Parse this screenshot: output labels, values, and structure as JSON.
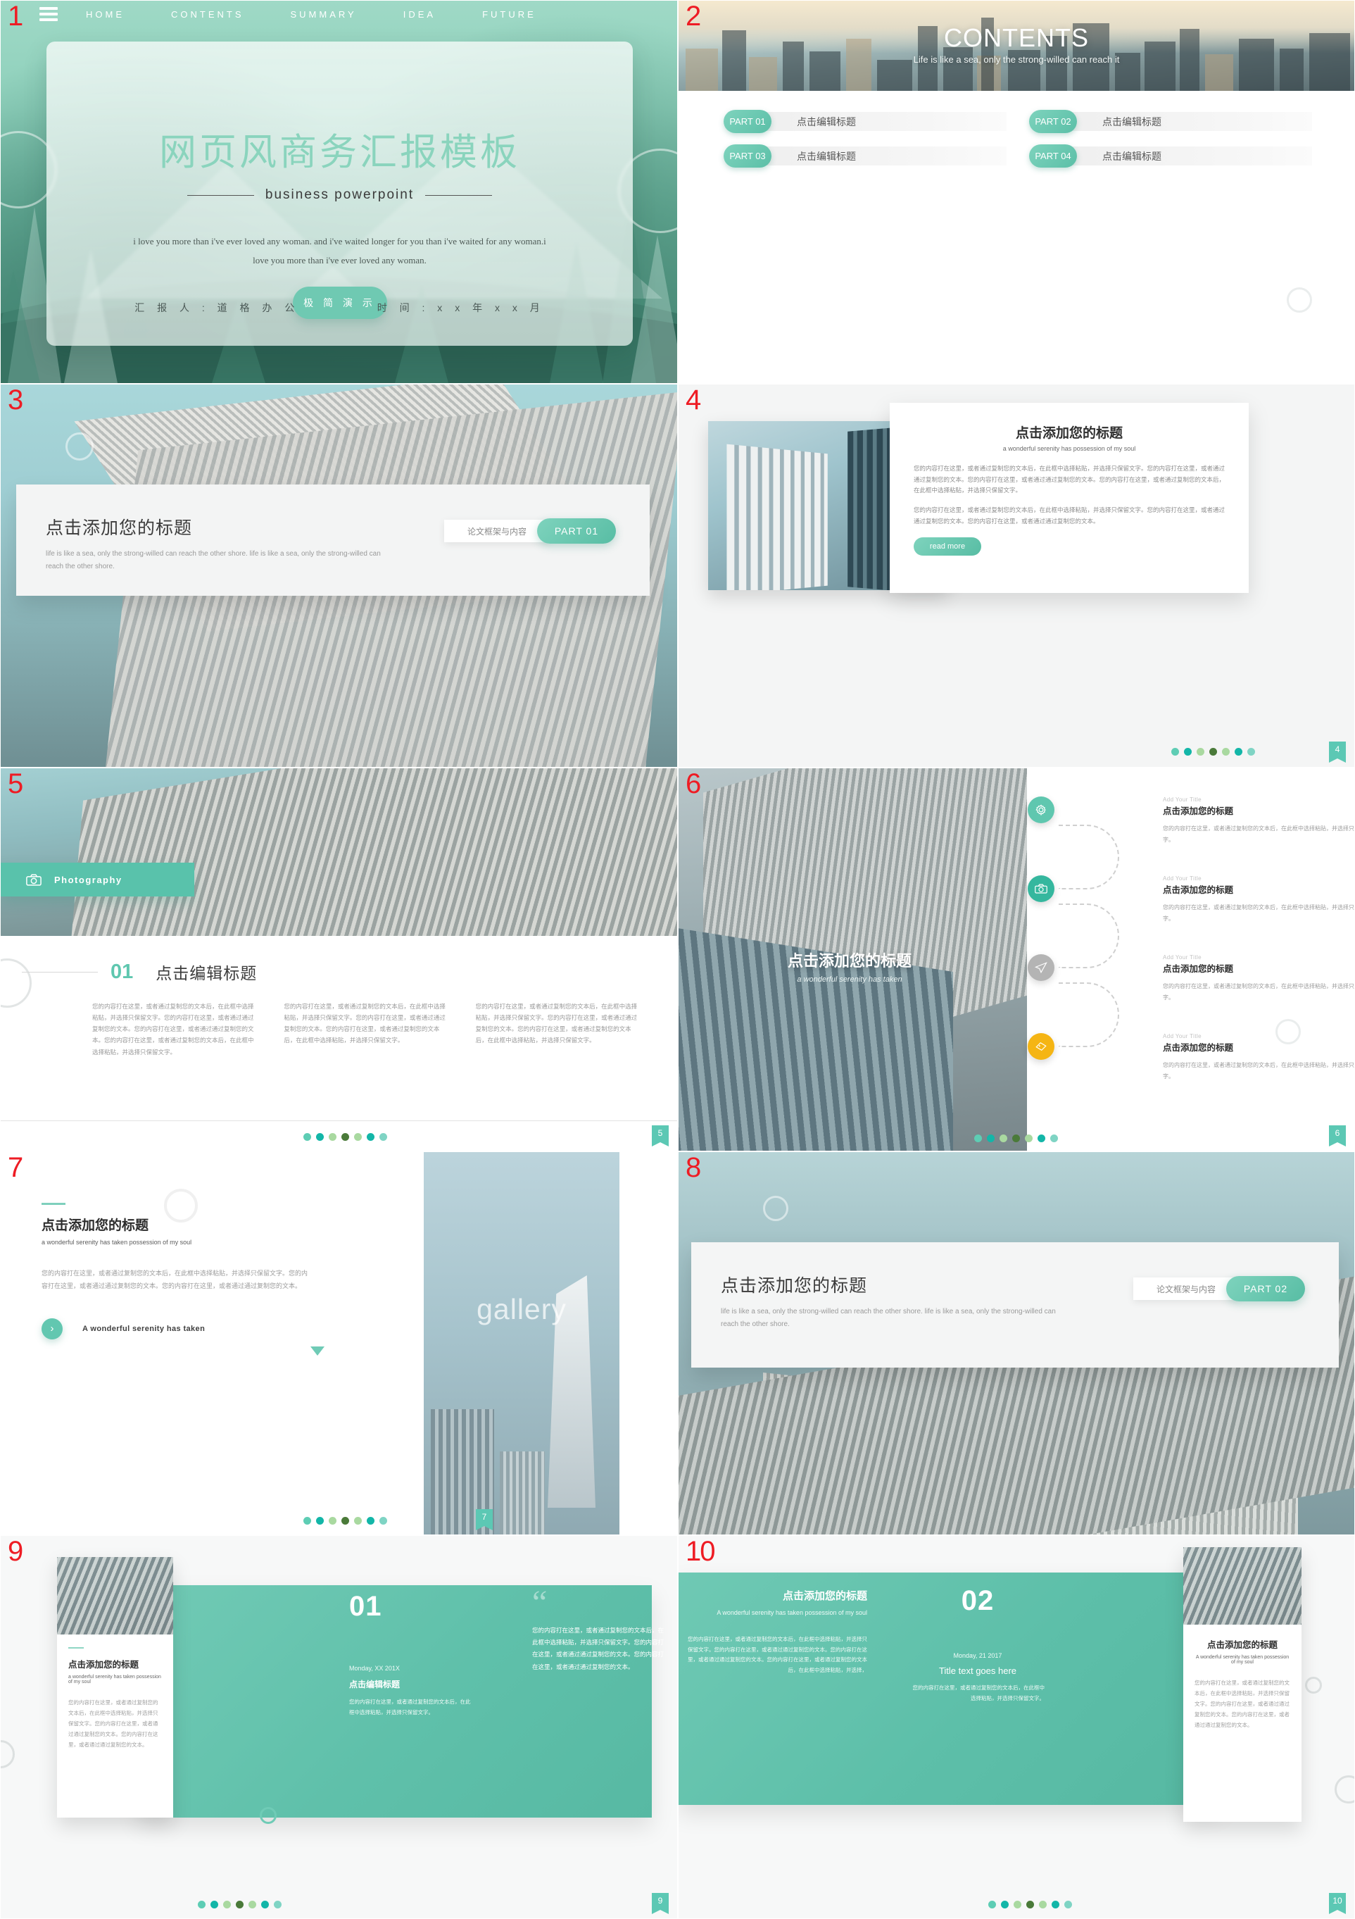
{
  "deck": {
    "accent": "#5fc7af",
    "accent_dark": "#3fae93",
    "red": "#ee1c24",
    "dot_palette": [
      "#5ecdb4",
      "#13b6a8",
      "#a9d9a0",
      "#4a7a39",
      "#a9d9a0",
      "#13b6a8",
      "#7fd4c4"
    ]
  },
  "slide1": {
    "number": "1",
    "nav": [
      "HOME",
      "CONTENTS",
      "SUMMARY",
      "IDEA",
      "FUTURE"
    ],
    "title": "网页风商务汇报模板",
    "subtitle": "business powerpoint",
    "quote": "i love you more than i've ever loved any woman. and i've waited longer for you than i've waited for any woman.i love you more than i've ever loved any woman.",
    "cta": "极 简 演 示",
    "presenter": "汇 报 人 :  道 格 办 公",
    "date": "时 间 :  x x 年 x x 月"
  },
  "slide2": {
    "number": "2",
    "hero_title": "CONTENTS",
    "hero_sub": "Life is like a sea, only the strong-willed can reach it",
    "parts": [
      {
        "tag": "PART 01",
        "title": "点击编辑标题"
      },
      {
        "tag": "PART 02",
        "title": "点击编辑标题"
      },
      {
        "tag": "PART 03",
        "title": "点击编辑标题"
      },
      {
        "tag": "PART 04",
        "title": "点击编辑标题"
      }
    ]
  },
  "slide3": {
    "number": "3",
    "title": "点击添加您的标题",
    "desc": "life is like a sea, only the strong-willed can reach the other shore. life is like a sea, only the strong-willed can reach the other shore.",
    "btn_label": "论文框架与内容",
    "btn_pill": "PART 01"
  },
  "slide4": {
    "number": "4",
    "page": "4",
    "title": "点击添加您的标题",
    "subtitle": "a wonderful serenity has possession of my soul",
    "body1": "您的内容打在这里，或者通过复制您的文本后，在此框中选择粘贴，并选择只保留文字。您的内容打在这里，或者通过通过复制您的文本。您的内容打在这里，或者通过通过复制您的文本。您的内容打在这里，或者通过复制您的文本后，在此框中选择粘贴，并选择只保留文字。",
    "body2": "您的内容打在这里，或者通过复制您的文本后，在此框中选择粘贴，并选择只保留文字。您的内容打在这里，或者通过通过复制您的文本。您的内容打在这里，或者通过通过复制您的文本。",
    "read_more": "read more"
  },
  "slide5": {
    "number": "5",
    "page": "5",
    "photo_tag": "Photography",
    "index": "01",
    "title": "点击编辑标题",
    "col1": "您的内容打在这里，或者通过复制您的文本后，在此框中选择粘贴，并选择只保留文字。您的内容打在这里，或者通过通过复制您的文本。您的内容打在这里，或者通过通过复制您的文本。您的内容打在这里，或者通过复制您的文本后，在此框中选择粘贴，并选择只保留文字。",
    "col2": "您的内容打在这里，或者通过复制您的文本后，在此框中选择粘贴，并选择只保留文字。您的内容打在这里，或者通过通过复制您的文本。您的内容打在这里，或者通过复制您的文本后，在此框中选择粘贴，并选择只保留文字。",
    "col3": "您的内容打在这里，或者通过复制您的文本后，在此框中选择粘贴，并选择只保留文字。您的内容打在这里，或者通过通过复制您的文本。您的内容打在这里，或者通过复制您的文本后，在此框中选择粘贴，并选择只保留文字。"
  },
  "slide6": {
    "number": "6",
    "page": "6",
    "title": "点击添加您的标题",
    "subtitle": "a wonderful serenity has taken",
    "steps": [
      {
        "icon": "gear-icon",
        "color": "#5fc7af",
        "eyebrow": "Add Your Title",
        "title": "点击添加您的标题",
        "body": "您的内容打在这里，或者通过复制您的文本后，在此框中选择粘贴，并选择只保留文字。"
      },
      {
        "icon": "camera-icon",
        "color": "#35b79e",
        "eyebrow": "Add Your Title",
        "title": "点击添加您的标题",
        "body": "您的内容打在这里，或者通过复制您的文本后，在此框中选择粘贴，并选择只保留文字。"
      },
      {
        "icon": "send-icon",
        "color": "#b4b4b4",
        "eyebrow": "Add Your Title",
        "title": "点击添加您的标题",
        "body": "您的内容打在这里，或者通过复制您的文本后，在此框中选择粘贴，并选择只保留文字。"
      },
      {
        "icon": "tag-icon",
        "color": "#f5b514",
        "eyebrow": "Add Your Title",
        "title": "点击添加您的标题",
        "body": "您的内容打在这里，或者通过复制您的文本后，在此框中选择粘贴，并选择只保留文字。"
      }
    ]
  },
  "slide7": {
    "number": "7",
    "page": "7",
    "title": "点击添加您的标题",
    "subtitle": "a wonderful serenity has taken possession of my soul",
    "body": "您的内容打在这里，或者通过复制您的文本后，在此框中选择粘贴，并选择只保留文字。您的内容打在这里，或者通过通过复制您的文本。您的内容打在这里，或者通过通过复制您的文本。",
    "cta": "A wonderful serenity has taken",
    "gallery_word": "gallery"
  },
  "slide8": {
    "number": "8",
    "title": "点击添加您的标题",
    "desc": "life is like a sea, only the strong-willed can reach the other shore. life is like a sea, only the strong-willed can reach the other shore.",
    "btn_label": "论文框架与内容",
    "btn_pill": "PART 02"
  },
  "slide9": {
    "number": "9",
    "page": "9",
    "card": {
      "title": "点击添加您的标题",
      "subtitle": "a wonderful  serenity has taken possession of my soul",
      "body": "您的内容打在这里，或者通过复制您的文本后，在此框中选择粘贴，并选择只保留文字。您的内容打在这里，或者通过通过复制您的文本。您的内容打在这里，或者通过通过复制您的文本。"
    },
    "index": "01",
    "date": "Monday, XX 201X",
    "band_title": "点击编辑标题",
    "band_body": "您的内容打在这里，或者通过复制您的文本后，在此框中选择粘贴，并选择只保留文字。",
    "quote_body": "您的内容打在这里，或者通过复制您的文本后，在此框中选择粘贴，并选择只保留文字。您的内容打在这里，或者通过通过复制您的文本。您的内容打在这里，或者通过通过复制您的文本。"
  },
  "slide10": {
    "number": "10",
    "page": "10",
    "band_title": "点击添加您的标题",
    "band_sub": "A wonderful  serenity has taken possession of my soul",
    "band_body": "您的内容打在这里，或者通过复制您的文本后，在此框中选择粘贴，并选择只保留文字。您的内容打在这里，或者通过通过复制您的文本。您的内容打在这里，或者通过通过复制您的文本。您的内容打在这里，或者通过复制您的文本后，在此框中选择粘贴，并选择，",
    "index": "02",
    "date": "Monday, 21 2017",
    "mid_title": "Title text goes here",
    "mid_body": "您的内容打在这里，或者通过复制您的文本后，在此框中选择粘贴，并选择只保留文字。",
    "card": {
      "title": "点击添加您的标题",
      "subtitle": "A wonderful  serenity has taken possession of my soul",
      "body": "您的内容打在这里，或者通过复制您的文本后，在此框中选择粘贴，并选择只保留文字。您的内容打在这里，或者通过通过复制您的文本。您的内容打在这里，或者通过通过复制您的文本。"
    }
  }
}
